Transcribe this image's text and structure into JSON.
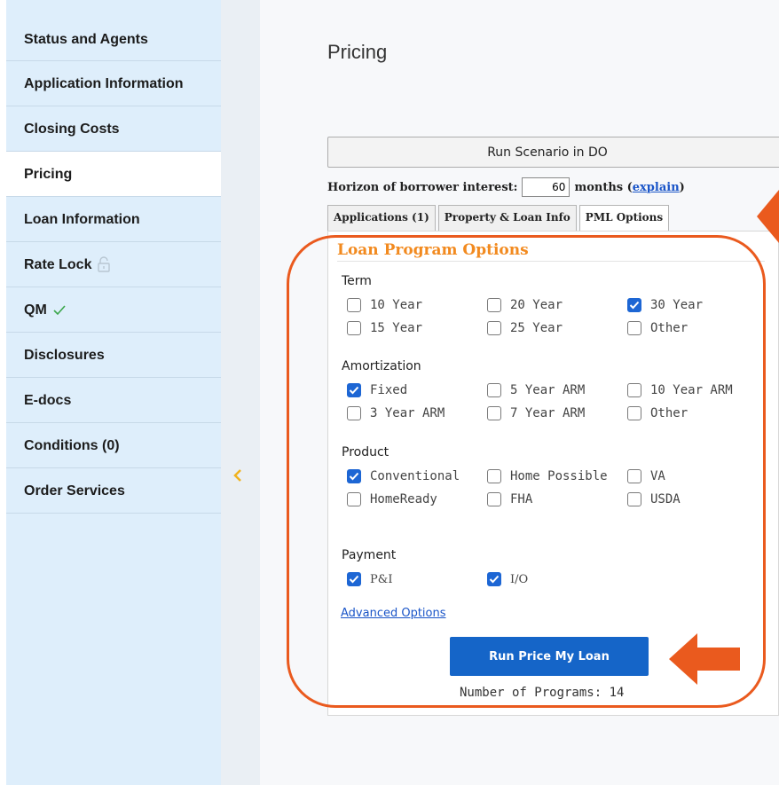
{
  "sidebar": {
    "items": [
      {
        "label": "Status and Agents"
      },
      {
        "label": "Application Information"
      },
      {
        "label": "Closing Costs"
      },
      {
        "label": "Pricing"
      },
      {
        "label": "Loan Information"
      },
      {
        "label": "Rate Lock"
      },
      {
        "label": "QM"
      },
      {
        "label": "Disclosures"
      },
      {
        "label": "E-docs"
      },
      {
        "label": "Conditions (0)"
      },
      {
        "label": "Order Services"
      }
    ]
  },
  "page": {
    "title": "Pricing"
  },
  "run_scenario": {
    "label": "Run Scenario in DO"
  },
  "horizon": {
    "label": "Horizon of borrower interest:",
    "value": "60",
    "unit": "months (",
    "link": "explain",
    "close": ")"
  },
  "tabs": [
    {
      "label": "Applications (1)"
    },
    {
      "label": "Property & Loan Info"
    },
    {
      "label": "PML Options"
    }
  ],
  "loan_program": {
    "title": "Loan Program Options",
    "term": {
      "heading": "Term",
      "options": [
        {
          "label": "10 Year",
          "checked": false
        },
        {
          "label": "20 Year",
          "checked": false
        },
        {
          "label": "30 Year",
          "checked": true
        },
        {
          "label": "15 Year",
          "checked": false
        },
        {
          "label": "25 Year",
          "checked": false
        },
        {
          "label": "Other",
          "checked": false
        }
      ]
    },
    "amortization": {
      "heading": "Amortization",
      "options": [
        {
          "label": "Fixed",
          "checked": true
        },
        {
          "label": "5 Year ARM",
          "checked": false
        },
        {
          "label": "10 Year ARM",
          "checked": false
        },
        {
          "label": "3 Year ARM",
          "checked": false
        },
        {
          "label": "7 Year ARM",
          "checked": false
        },
        {
          "label": "Other",
          "checked": false
        }
      ]
    },
    "product": {
      "heading": "Product",
      "options": [
        {
          "label": "Conventional",
          "checked": true
        },
        {
          "label": "Home Possible",
          "checked": false
        },
        {
          "label": "VA",
          "checked": false
        },
        {
          "label": "HomeReady",
          "checked": false
        },
        {
          "label": "FHA",
          "checked": false
        },
        {
          "label": "USDA",
          "checked": false
        }
      ]
    },
    "payment": {
      "heading": "Payment",
      "options": [
        {
          "label": "P&I",
          "checked": true
        },
        {
          "label": "I/O",
          "checked": true
        }
      ]
    },
    "advanced_link": "Advanced Options",
    "run_button": "Run Price My Loan",
    "programs_count": "Number of Programs: 14"
  },
  "colors": {
    "accent_orange": "#f28a1f",
    "annotation": "#ea5a1e",
    "primary_blue": "#1565c8",
    "sidebar_bg": "#deeefb"
  }
}
